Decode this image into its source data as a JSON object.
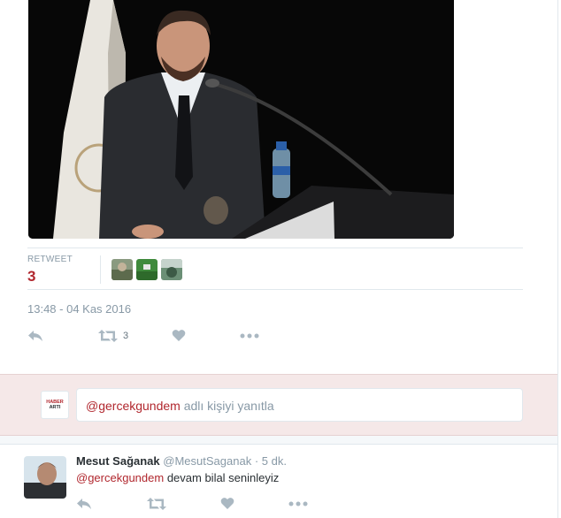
{
  "tweet": {
    "retweet_label": "RETWEET",
    "retweet_count": "3",
    "timestamp": "13:48 - 04 Kas 2016",
    "action_retweet_count": "3",
    "icons": [
      "reply-icon",
      "retweet-icon",
      "like-icon",
      "more-icon"
    ]
  },
  "reply_box": {
    "avatar_text_top": "HABER",
    "avatar_text_bottom": "ARTI",
    "mention": "@gercekgundem",
    "placeholder_rest": " adlı kişiyi yanıtla"
  },
  "reply_tweet": {
    "name": "Mesut Sağanak",
    "handle": "@MesutSaganak",
    "separator": " · ",
    "time": "5 dk.",
    "mention": "@gercekgundem",
    "text": " devam bilal seninleyiz"
  },
  "colors": {
    "accent": "#b1272e",
    "muted": "#8899a6",
    "reply_bar_bg": "#f5e8e8"
  }
}
